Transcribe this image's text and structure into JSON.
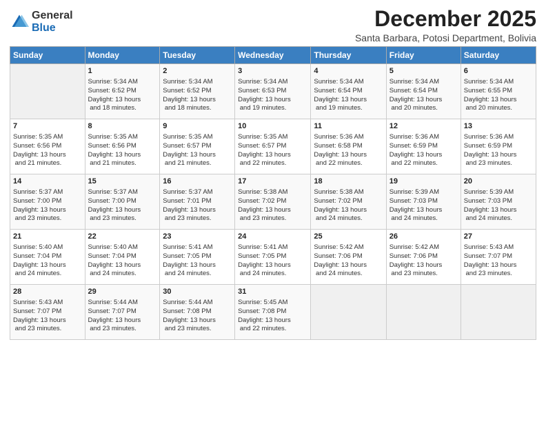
{
  "logo": {
    "general": "General",
    "blue": "Blue"
  },
  "title": "December 2025",
  "location": "Santa Barbara, Potosi Department, Bolivia",
  "days_of_week": [
    "Sunday",
    "Monday",
    "Tuesday",
    "Wednesday",
    "Thursday",
    "Friday",
    "Saturday"
  ],
  "weeks": [
    [
      {
        "day": "",
        "sunrise": "",
        "sunset": "",
        "daylight": ""
      },
      {
        "day": "1",
        "sunrise": "Sunrise: 5:34 AM",
        "sunset": "Sunset: 6:52 PM",
        "daylight": "Daylight: 13 hours and 18 minutes."
      },
      {
        "day": "2",
        "sunrise": "Sunrise: 5:34 AM",
        "sunset": "Sunset: 6:52 PM",
        "daylight": "Daylight: 13 hours and 18 minutes."
      },
      {
        "day": "3",
        "sunrise": "Sunrise: 5:34 AM",
        "sunset": "Sunset: 6:53 PM",
        "daylight": "Daylight: 13 hours and 19 minutes."
      },
      {
        "day": "4",
        "sunrise": "Sunrise: 5:34 AM",
        "sunset": "Sunset: 6:54 PM",
        "daylight": "Daylight: 13 hours and 19 minutes."
      },
      {
        "day": "5",
        "sunrise": "Sunrise: 5:34 AM",
        "sunset": "Sunset: 6:54 PM",
        "daylight": "Daylight: 13 hours and 20 minutes."
      },
      {
        "day": "6",
        "sunrise": "Sunrise: 5:34 AM",
        "sunset": "Sunset: 6:55 PM",
        "daylight": "Daylight: 13 hours and 20 minutes."
      }
    ],
    [
      {
        "day": "7",
        "sunrise": "Sunrise: 5:35 AM",
        "sunset": "Sunset: 6:56 PM",
        "daylight": "Daylight: 13 hours and 21 minutes."
      },
      {
        "day": "8",
        "sunrise": "Sunrise: 5:35 AM",
        "sunset": "Sunset: 6:56 PM",
        "daylight": "Daylight: 13 hours and 21 minutes."
      },
      {
        "day": "9",
        "sunrise": "Sunrise: 5:35 AM",
        "sunset": "Sunset: 6:57 PM",
        "daylight": "Daylight: 13 hours and 21 minutes."
      },
      {
        "day": "10",
        "sunrise": "Sunrise: 5:35 AM",
        "sunset": "Sunset: 6:57 PM",
        "daylight": "Daylight: 13 hours and 22 minutes."
      },
      {
        "day": "11",
        "sunrise": "Sunrise: 5:36 AM",
        "sunset": "Sunset: 6:58 PM",
        "daylight": "Daylight: 13 hours and 22 minutes."
      },
      {
        "day": "12",
        "sunrise": "Sunrise: 5:36 AM",
        "sunset": "Sunset: 6:59 PM",
        "daylight": "Daylight: 13 hours and 22 minutes."
      },
      {
        "day": "13",
        "sunrise": "Sunrise: 5:36 AM",
        "sunset": "Sunset: 6:59 PM",
        "daylight": "Daylight: 13 hours and 23 minutes."
      }
    ],
    [
      {
        "day": "14",
        "sunrise": "Sunrise: 5:37 AM",
        "sunset": "Sunset: 7:00 PM",
        "daylight": "Daylight: 13 hours and 23 minutes."
      },
      {
        "day": "15",
        "sunrise": "Sunrise: 5:37 AM",
        "sunset": "Sunset: 7:00 PM",
        "daylight": "Daylight: 13 hours and 23 minutes."
      },
      {
        "day": "16",
        "sunrise": "Sunrise: 5:37 AM",
        "sunset": "Sunset: 7:01 PM",
        "daylight": "Daylight: 13 hours and 23 minutes."
      },
      {
        "day": "17",
        "sunrise": "Sunrise: 5:38 AM",
        "sunset": "Sunset: 7:02 PM",
        "daylight": "Daylight: 13 hours and 23 minutes."
      },
      {
        "day": "18",
        "sunrise": "Sunrise: 5:38 AM",
        "sunset": "Sunset: 7:02 PM",
        "daylight": "Daylight: 13 hours and 24 minutes."
      },
      {
        "day": "19",
        "sunrise": "Sunrise: 5:39 AM",
        "sunset": "Sunset: 7:03 PM",
        "daylight": "Daylight: 13 hours and 24 minutes."
      },
      {
        "day": "20",
        "sunrise": "Sunrise: 5:39 AM",
        "sunset": "Sunset: 7:03 PM",
        "daylight": "Daylight: 13 hours and 24 minutes."
      }
    ],
    [
      {
        "day": "21",
        "sunrise": "Sunrise: 5:40 AM",
        "sunset": "Sunset: 7:04 PM",
        "daylight": "Daylight: 13 hours and 24 minutes."
      },
      {
        "day": "22",
        "sunrise": "Sunrise: 5:40 AM",
        "sunset": "Sunset: 7:04 PM",
        "daylight": "Daylight: 13 hours and 24 minutes."
      },
      {
        "day": "23",
        "sunrise": "Sunrise: 5:41 AM",
        "sunset": "Sunset: 7:05 PM",
        "daylight": "Daylight: 13 hours and 24 minutes."
      },
      {
        "day": "24",
        "sunrise": "Sunrise: 5:41 AM",
        "sunset": "Sunset: 7:05 PM",
        "daylight": "Daylight: 13 hours and 24 minutes."
      },
      {
        "day": "25",
        "sunrise": "Sunrise: 5:42 AM",
        "sunset": "Sunset: 7:06 PM",
        "daylight": "Daylight: 13 hours and 24 minutes."
      },
      {
        "day": "26",
        "sunrise": "Sunrise: 5:42 AM",
        "sunset": "Sunset: 7:06 PM",
        "daylight": "Daylight: 13 hours and 23 minutes."
      },
      {
        "day": "27",
        "sunrise": "Sunrise: 5:43 AM",
        "sunset": "Sunset: 7:07 PM",
        "daylight": "Daylight: 13 hours and 23 minutes."
      }
    ],
    [
      {
        "day": "28",
        "sunrise": "Sunrise: 5:43 AM",
        "sunset": "Sunset: 7:07 PM",
        "daylight": "Daylight: 13 hours and 23 minutes."
      },
      {
        "day": "29",
        "sunrise": "Sunrise: 5:44 AM",
        "sunset": "Sunset: 7:07 PM",
        "daylight": "Daylight: 13 hours and 23 minutes."
      },
      {
        "day": "30",
        "sunrise": "Sunrise: 5:44 AM",
        "sunset": "Sunset: 7:08 PM",
        "daylight": "Daylight: 13 hours and 23 minutes."
      },
      {
        "day": "31",
        "sunrise": "Sunrise: 5:45 AM",
        "sunset": "Sunset: 7:08 PM",
        "daylight": "Daylight: 13 hours and 22 minutes."
      },
      {
        "day": "",
        "sunrise": "",
        "sunset": "",
        "daylight": ""
      },
      {
        "day": "",
        "sunrise": "",
        "sunset": "",
        "daylight": ""
      },
      {
        "day": "",
        "sunrise": "",
        "sunset": "",
        "daylight": ""
      }
    ]
  ]
}
